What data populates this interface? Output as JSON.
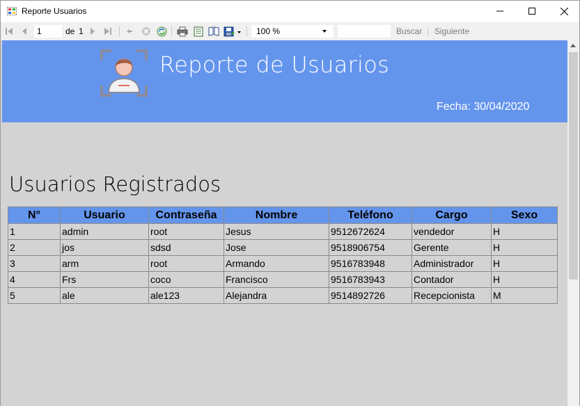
{
  "window": {
    "title": "Reporte Usuarios",
    "minimize_icon": "minimize-icon",
    "maximize_icon": "maximize-icon",
    "close_icon": "close-icon"
  },
  "toolbar": {
    "current_page": "1",
    "of_label": "de",
    "total_pages": "1",
    "zoom": "100 %",
    "search_label": "Buscar",
    "next_label": "Siguiente",
    "icons": [
      "first-page-icon",
      "previous-page-icon",
      "next-page-icon",
      "last-page-icon",
      "back-icon",
      "stop-icon",
      "refresh-icon",
      "print-icon",
      "print-layout-icon",
      "page-setup-icon",
      "export-icon"
    ]
  },
  "report": {
    "title": "Reporte de Usuarios",
    "date": "Fecha: 30/04/2020",
    "logo_icon": "user-scan-icon",
    "banner_color": "#6495ed",
    "background_color": "#d3d3d3",
    "section_title": "Usuarios Registrados",
    "columns": [
      "N°",
      "Usuario",
      "Contraseña",
      "Nombre",
      "Teléfono",
      "Cargo",
      "Sexo"
    ],
    "rows": [
      [
        "1",
        "admin",
        "root",
        "Jesus",
        "9512672624",
        "vendedor",
        "H"
      ],
      [
        "2",
        "jos",
        "sdsd",
        "Jose",
        "9518906754",
        "Gerente",
        "H"
      ],
      [
        "3",
        "arm",
        "root",
        "Armando",
        "9516783948",
        "Administrador",
        "H"
      ],
      [
        "4",
        "Frs",
        "coco",
        "Francisco",
        "9516783943",
        "Contador",
        "H"
      ],
      [
        "5",
        "ale",
        "ale123",
        "Alejandra",
        "9514892726",
        "Recepcionista",
        "M"
      ]
    ]
  }
}
